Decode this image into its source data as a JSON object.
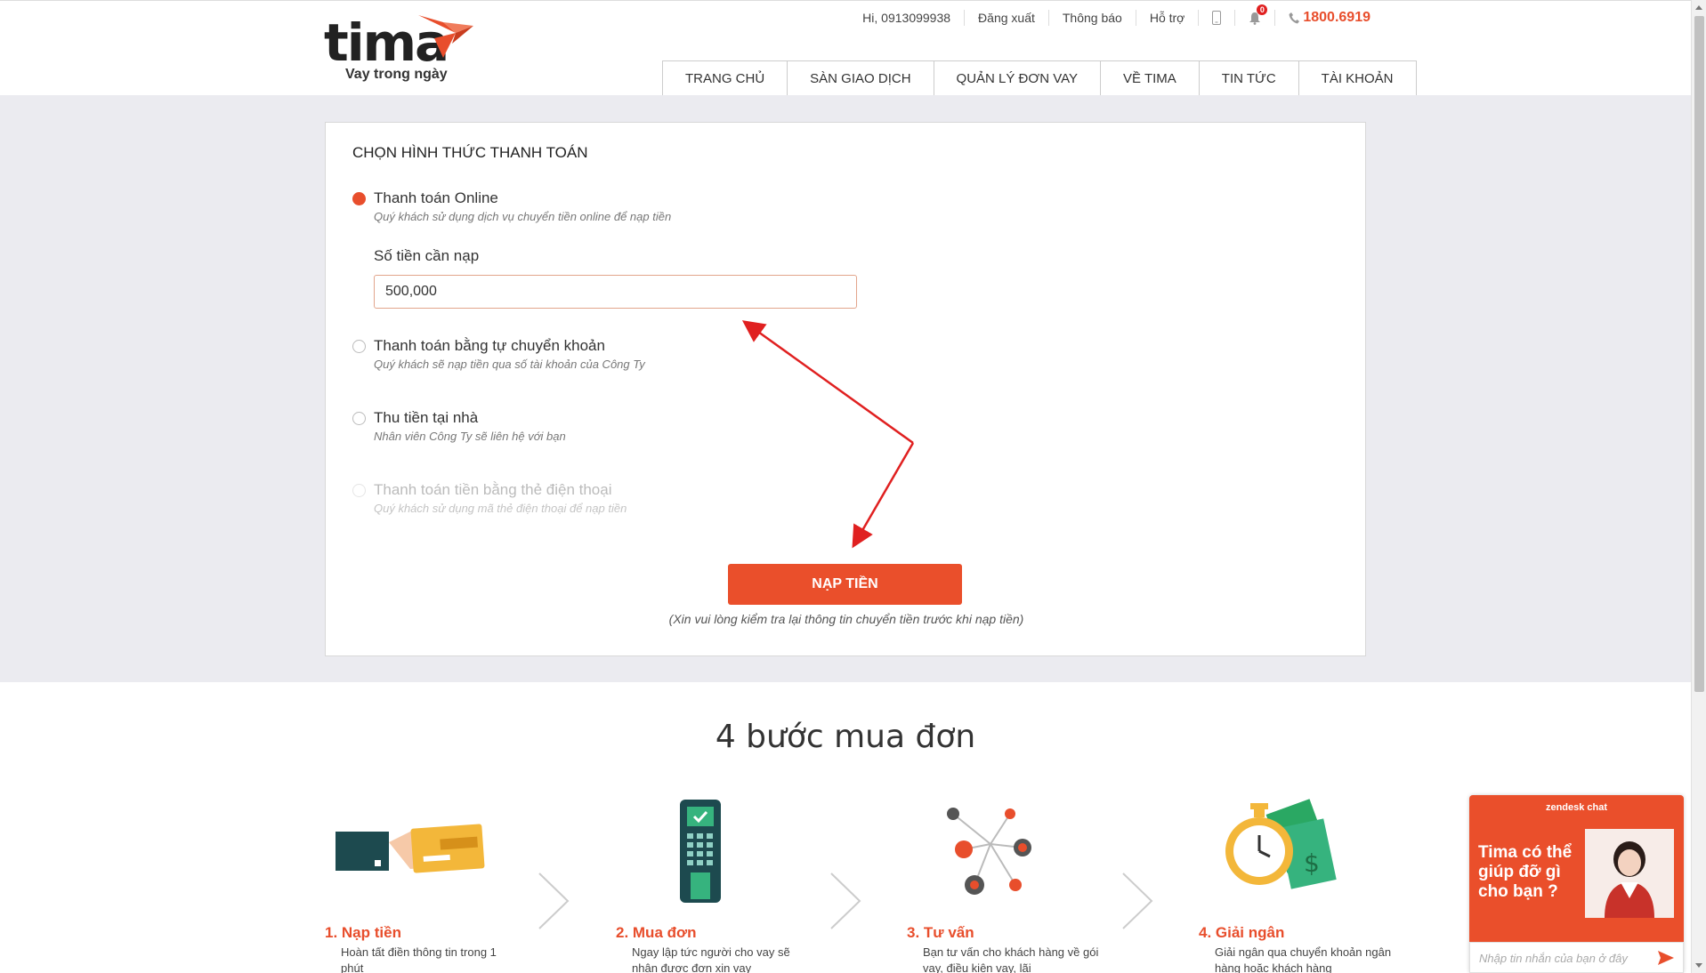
{
  "brand": {
    "logo_word": "tima",
    "tagline": "Vay trong ngày",
    "accent": "#e84e2c"
  },
  "topbar": {
    "greeting": "Hi, 0913099938",
    "logout": "Đăng xuất",
    "notifications": "Thông báo",
    "support": "Hỗ trợ",
    "bell_count": "0",
    "hotline": "1800.6919"
  },
  "nav": {
    "tabs": [
      "TRANG CHỦ",
      "SÀN GIAO DỊCH",
      "QUẢN LÝ ĐƠN VAY",
      "VỀ TIMA",
      "TIN TỨC",
      "TÀI KHOẢN"
    ]
  },
  "payment": {
    "title": "CHỌN HÌNH THỨC THANH TOÁN",
    "options": [
      {
        "label": "Thanh toán Online",
        "desc": "Quý khách sử dụng dịch vụ chuyển tiền online để nạp tiền",
        "state": "checked"
      },
      {
        "label": "Thanh toán bằng tự chuyển khoản",
        "desc": "Quý khách sẽ nạp tiền qua số tài khoản của Công Ty",
        "state": "unchecked"
      },
      {
        "label": "Thu tiền tại nhà",
        "desc": "Nhân viên Công Ty sẽ liên hệ với bạn",
        "state": "unchecked"
      },
      {
        "label": "Thanh toán tiền bằng thẻ điện thoại",
        "desc": "Quý khách sử dụng mã thẻ điện thoại để nạp tiền",
        "state": "disabled"
      }
    ],
    "amount_label": "Số tiền cần nạp",
    "amount_value": "500,000",
    "submit_label": "NẠP TIỀN",
    "note": "(Xin vui lòng kiểm tra lại thông tin chuyển tiền trước khi nạp tiền)"
  },
  "steps": {
    "title": "4 bước mua đơn",
    "items": [
      {
        "title": "1. Nạp tiền",
        "desc": "Hoàn tất điền thông tin trong 1 phút"
      },
      {
        "title": "2. Mua đơn",
        "desc": "Ngay lập tức người cho vay sẽ nhận được đơn xin vay"
      },
      {
        "title": "3. Tư vấn",
        "desc": "Bạn tư vấn cho khách hàng về gói vay, điều kiện vay, lãi"
      },
      {
        "title": "4. Giải ngân",
        "desc": "Giải ngân qua chuyển khoản ngân hàng hoặc khách hàng"
      }
    ]
  },
  "chat": {
    "brand": "zendesk chat",
    "message": "Tima có thể giúp đỡ gì cho bạn ?",
    "input_placeholder": "Nhập tin nhắn của bạn ở đây"
  }
}
